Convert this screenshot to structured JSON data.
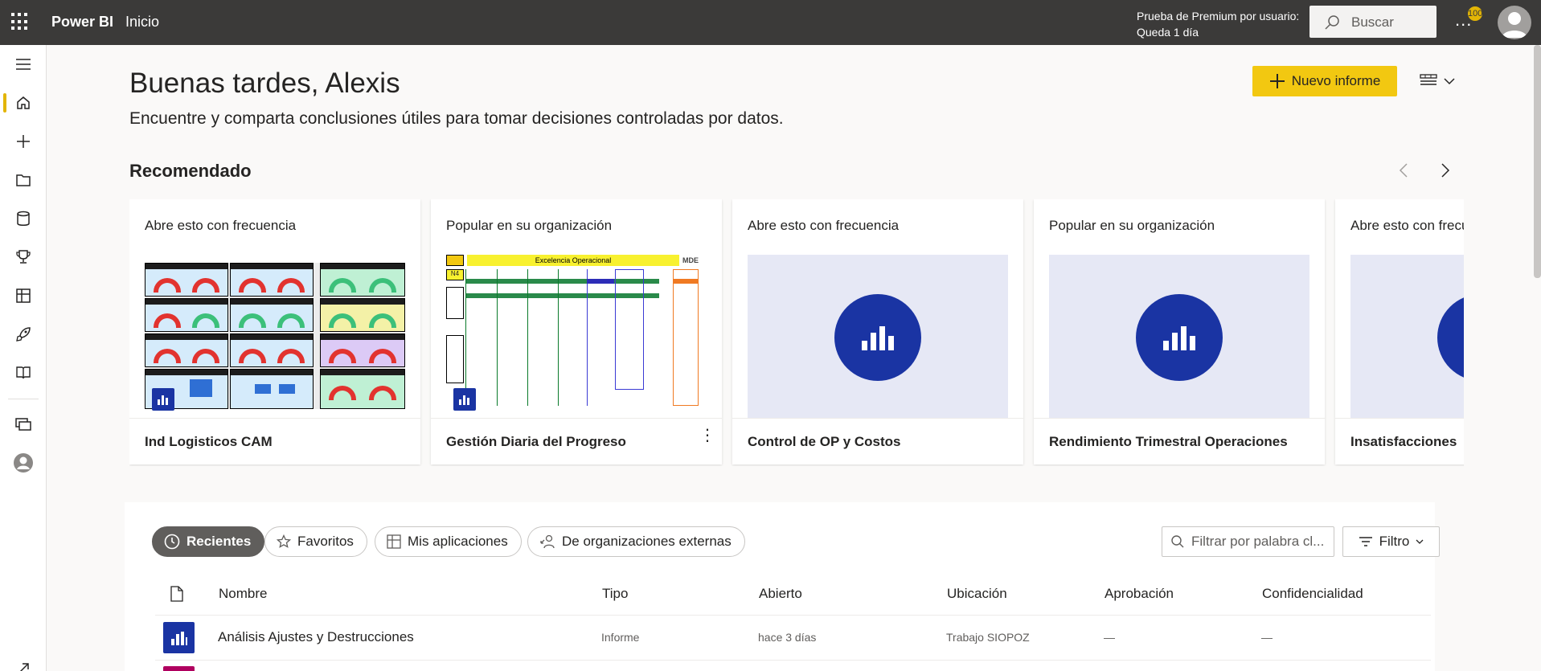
{
  "topbar": {
    "app_name": "Power BI",
    "breadcrumb": "Inicio",
    "trial_line1": "Prueba de Premium por usuario:",
    "trial_line2": "Queda 1 día",
    "search_placeholder": "Buscar",
    "more_label": "...",
    "notification_count": "100"
  },
  "leftnav": {
    "items": [
      "menu-icon",
      "home-icon",
      "create-icon",
      "browse-icon",
      "data-hub-icon",
      "metrics-icon",
      "apps-icon",
      "learn-icon",
      "learn-book-icon",
      "workspaces-icon",
      "my-workspace-icon",
      "expand-icon"
    ]
  },
  "main": {
    "greeting": "Buenas tardes, Alexis",
    "subtitle": "Encuentre y comparta conclusiones útiles para tomar decisiones controladas por datos.",
    "new_report_label": "Nuevo informe",
    "recommended_title": "Recomendado"
  },
  "cards": [
    {
      "tag": "Abre esto con frecuencia",
      "name": "Ind Logisticos CAM",
      "thumb": "dashboard"
    },
    {
      "tag": "Popular en su organización",
      "name": "Gestión Diaria del Progreso",
      "thumb": "operational",
      "thumb_title": "Excelencia Operacional"
    },
    {
      "tag": "Abre esto con frecuencia",
      "name": "Control de OP y Costos",
      "thumb": "generic"
    },
    {
      "tag": "Popular en su organización",
      "name": "Rendimiento Trimestral Operaciones",
      "thumb": "generic"
    },
    {
      "tag": "Abre esto con frecuencia",
      "name": "Insatisfacciones",
      "thumb": "generic"
    }
  ],
  "filters": {
    "tabs": [
      "Recientes",
      "Favoritos",
      "Mis aplicaciones",
      "De organizaciones externas"
    ],
    "selected": "Recientes",
    "search_placeholder": "Filtrar por palabra cl...",
    "filter_label": "Filtro"
  },
  "table": {
    "columns": [
      "Nombre",
      "Tipo",
      "Abierto",
      "Ubicación",
      "Aprobación",
      "Confidencialidad"
    ],
    "rows": [
      {
        "name": "Análisis Ajustes y Destrucciones",
        "type": "Informe",
        "opened": "hace 3 días",
        "location": "Trabajo SIOPOZ",
        "approval": "—",
        "sensitivity": "—"
      }
    ]
  },
  "colors": {
    "topbar": "#3b3a39",
    "accent_yellow": "#f2c811",
    "report_blue": "#1a34a3"
  }
}
